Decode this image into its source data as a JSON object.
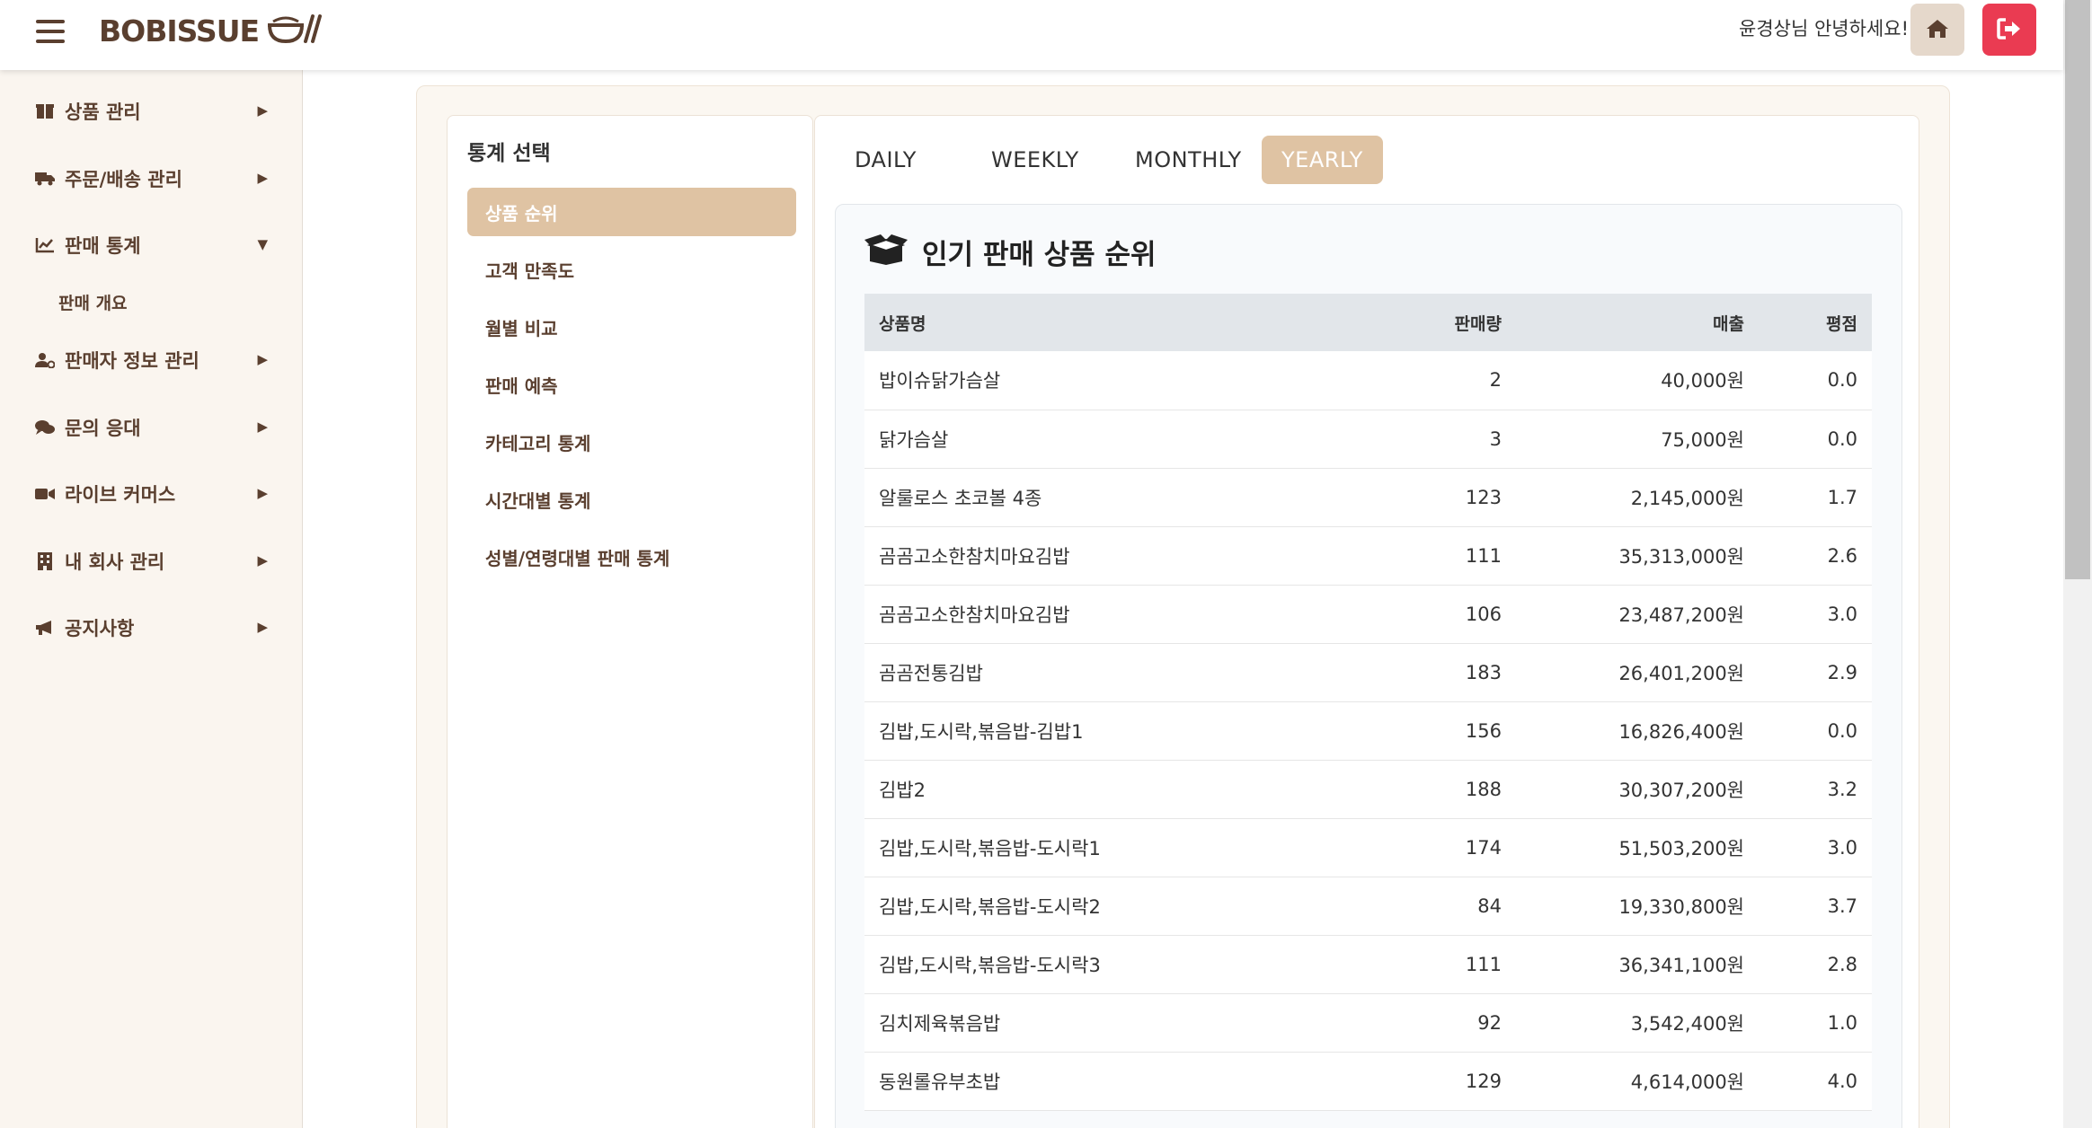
{
  "header": {
    "logo_text": "BOBISSUE",
    "greeting": "윤경상님 안녕하세요!"
  },
  "sidebar": {
    "items": [
      {
        "label": "상품 관리",
        "icon": "box-icon",
        "arrow": "▶"
      },
      {
        "label": "주문/배송 관리",
        "icon": "truck-icon",
        "arrow": "▶"
      },
      {
        "label": "판매 통계",
        "icon": "chart-line-icon",
        "arrow": "▼"
      },
      {
        "label": "판매자 정보 관리",
        "icon": "user-gear-icon",
        "arrow": "▶"
      },
      {
        "label": "문의 응대",
        "icon": "comments-icon",
        "arrow": "▶"
      },
      {
        "label": "라이브 커머스",
        "icon": "video-icon",
        "arrow": "▶"
      },
      {
        "label": "내 회사 관리",
        "icon": "building-icon",
        "arrow": "▶"
      },
      {
        "label": "공지사항",
        "icon": "bullhorn-icon",
        "arrow": "▶"
      }
    ],
    "sub_items": [
      "판매 개요"
    ]
  },
  "stats_menu": {
    "title": "통계 선택",
    "items": [
      "상품 순위",
      "고객 만족도",
      "월별 비교",
      "판매 예측",
      "카테고리 통계",
      "시간대별 통계",
      "성별/연령대별 판매 통계"
    ],
    "active_index": 0
  },
  "tabs": {
    "items": [
      "DAILY",
      "WEEKLY",
      "MONTHLY",
      "YEARLY"
    ],
    "active": "YEARLY"
  },
  "ranking": {
    "title": "인기 판매 상품 순위",
    "columns": [
      "상품명",
      "판매량",
      "매출",
      "평점"
    ],
    "rows": [
      [
        "밥이슈닭가슴살",
        "2",
        "40,000원",
        "0.0"
      ],
      [
        "닭가슴살",
        "3",
        "75,000원",
        "0.0"
      ],
      [
        "알룰로스 초코볼 4종",
        "123",
        "2,145,000원",
        "1.7"
      ],
      [
        "곰곰고소한참치마요김밥",
        "111",
        "35,313,000원",
        "2.6"
      ],
      [
        "곰곰고소한참치마요김밥",
        "106",
        "23,487,200원",
        "3.0"
      ],
      [
        "곰곰전통김밥",
        "183",
        "26,401,200원",
        "2.9"
      ],
      [
        "김밥,도시락,볶음밥-김밥1",
        "156",
        "16,826,400원",
        "0.0"
      ],
      [
        "김밥2",
        "188",
        "30,307,200원",
        "3.2"
      ],
      [
        "김밥,도시락,볶음밥-도시락1",
        "174",
        "51,503,200원",
        "3.0"
      ],
      [
        "김밥,도시락,볶음밥-도시락2",
        "84",
        "19,330,800원",
        "3.7"
      ],
      [
        "김밥,도시락,볶음밥-도시락3",
        "111",
        "36,341,100원",
        "2.8"
      ],
      [
        "김치제육볶음밥",
        "92",
        "3,542,400원",
        "1.0"
      ],
      [
        "동원롤유부초밥",
        "129",
        "4,614,000원",
        "4.0"
      ]
    ]
  },
  "colors": {
    "brand_brown": "#5a3f2f",
    "accent_tan": "#dfc3a3",
    "logout_red": "#ea3b52",
    "sidebar_bg": "#faf5ef"
  }
}
